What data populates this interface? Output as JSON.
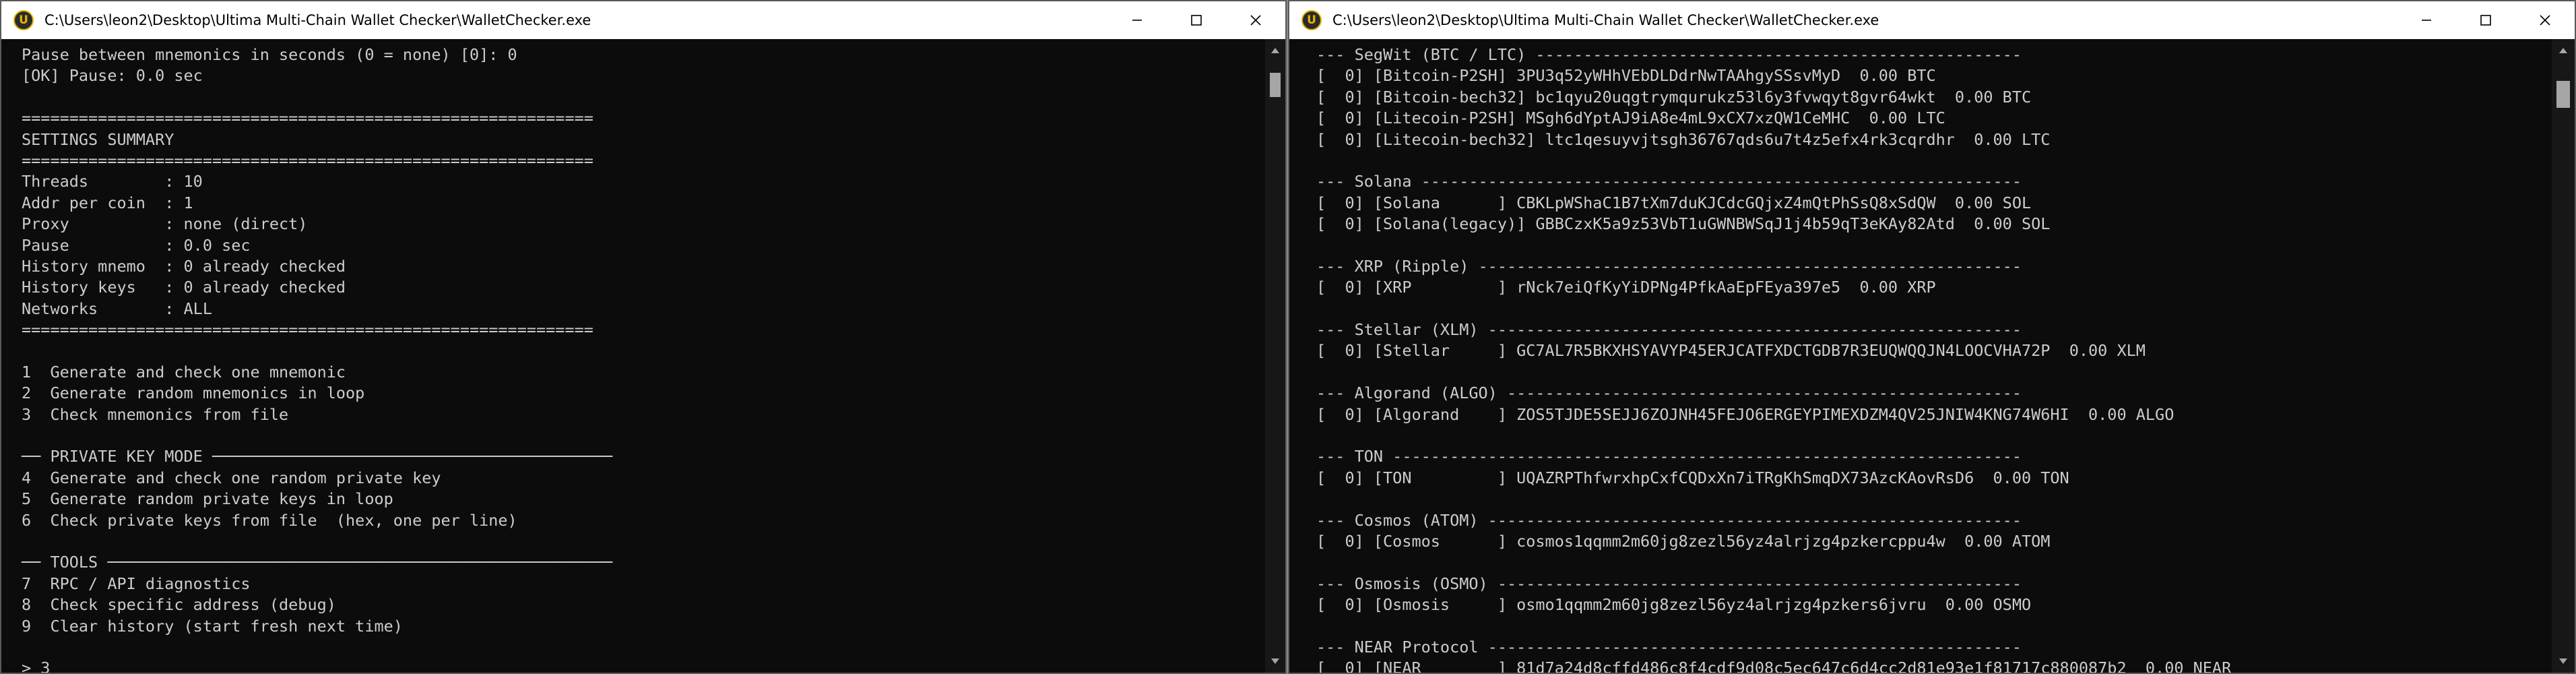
{
  "windows": [
    {
      "title": "C:\\Users\\leon2\\Desktop\\Ultima Multi-Chain Wallet Checker\\WalletChecker.exe",
      "icon": "ultima-app-icon",
      "icon_letter": "U",
      "lines": [
        "Pause between mnemonics in seconds (0 = none) [0]: 0",
        "[OK] Pause: 0.0 sec",
        "",
        "============================================================",
        "SETTINGS SUMMARY",
        "============================================================",
        "Threads        : 10",
        "Addr per coin  : 1",
        "Proxy          : none (direct)",
        "Pause          : 0.0 sec",
        "History mnemo  : 0 already checked",
        "History keys   : 0 already checked",
        "Networks       : ALL",
        "============================================================",
        "",
        "1  Generate and check one mnemonic",
        "2  Generate random mnemonics in loop",
        "3  Check mnemonics from file",
        "",
        "── PRIVATE KEY MODE ──────────────────────────────────────────",
        "4  Generate and check one random private key",
        "5  Generate random private keys in loop",
        "6  Check private keys from file  (hex, one per line)",
        "",
        "── TOOLS ─────────────────────────────────────────────────────",
        "7  RPC / API diagnostics",
        "8  Check specific address (debug)",
        "9  Clear history (start fresh next time)",
        "",
        "> 3"
      ]
    },
    {
      "title": "C:\\Users\\leon2\\Desktop\\Ultima Multi-Chain Wallet Checker\\WalletChecker.exe",
      "icon": "ultima-app-icon",
      "icon_letter": "U",
      "lines": [
        "--- SegWit (BTC / LTC) ---------------------------------------------------",
        "[  0] [Bitcoin-P2SH] 3PU3q52yWHhVEbDLDdrNwTAAhgySSsvMyD  0.00 BTC",
        "[  0] [Bitcoin-bech32] bc1qyu20uqgtrymqurukz53l6y3fvwqyt8gvr64wkt  0.00 BTC",
        "[  0] [Litecoin-P2SH] MSgh6dYptAJ9iA8e4mL9xCX7xzQW1CeMHC  0.00 LTC",
        "[  0] [Litecoin-bech32] ltc1qesuyvjtsgh36767qds6u7t4z5efx4rk3cqrdhr  0.00 LTC",
        "",
        "--- Solana ---------------------------------------------------------------",
        "[  0] [Solana      ] CBKLpWShaC1B7tXm7duKJCdcGQjxZ4mQtPhSsQ8xSdQW  0.00 SOL",
        "[  0] [Solana(legacy)] GBBCzxK5a9z53VbT1uGWNBWSqJ1j4b59qT3eKAy82Atd  0.00 SOL",
        "",
        "--- XRP (Ripple) ---------------------------------------------------------",
        "[  0] [XRP         ] rNck7eiQfKyYiDPNg4PfkAaEpFEya397e5  0.00 XRP",
        "",
        "--- Stellar (XLM) --------------------------------------------------------",
        "[  0] [Stellar     ] GC7AL7R5BKXHSYAVYP45ERJCATFXDCTGDB7R3EUQWQQJN4LOOCVHA72P  0.00 XLM",
        "",
        "--- Algorand (ALGO) ------------------------------------------------------",
        "[  0] [Algorand    ] ZOS5TJDE5SEJJ6ZOJNH45FEJO6ERGEYPIMEXDZM4QV25JNIW4KNG74W6HI  0.00 ALGO",
        "",
        "--- TON ------------------------------------------------------------------",
        "[  0] [TON         ] UQAZRPThfwrxhpCxfCQDxXn7iTRgKhSmqDX73AzcKAovRsD6  0.00 TON",
        "",
        "--- Cosmos (ATOM) --------------------------------------------------------",
        "[  0] [Cosmos      ] cosmos1qqmm2m60jg8zezl56yz4alrjzg4pzkercppu4w  0.00 ATOM",
        "",
        "--- Osmosis (OSMO) -------------------------------------------------------",
        "[  0] [Osmosis     ] osmo1qqmm2m60jg8zezl56yz4alrjzg4pzkers6jvru  0.00 OSMO",
        "",
        "--- NEAR Protocol --------------------------------------------------------",
        "[  0] [NEAR        ] 81d7a24d8cffd486c8f4cdf9d08c5ec647c6d4cc2d81e93e1f81717c880087b2  0.00 NEAR"
      ]
    }
  ],
  "colors": {
    "console_bg": "#0c0c0c",
    "console_text": "#cccccc",
    "titlebar_bg": "#ffffff",
    "scrollbar_thumb": "#a6a6a6"
  }
}
